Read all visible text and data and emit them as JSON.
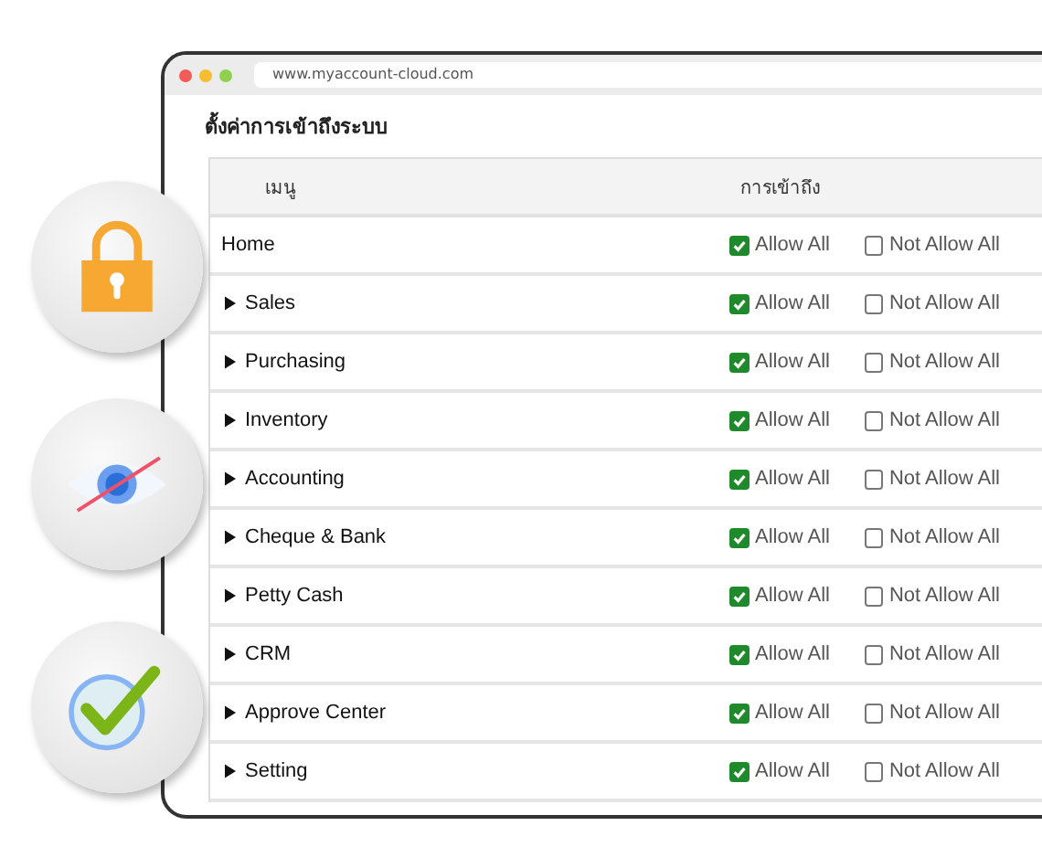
{
  "browser": {
    "url": "www.myaccount-cloud.com"
  },
  "page_title": "ตั้งค่าการเข้าถึงระบบ",
  "table": {
    "columns": [
      "เมนู",
      "การเข้าถึง"
    ],
    "rows": [
      {
        "name": "Home",
        "expandable": false,
        "allow": {
          "label": "Allow All",
          "checked": true
        },
        "deny": {
          "label": "Not Allow All",
          "checked": false
        }
      },
      {
        "name": "Sales",
        "expandable": true,
        "allow": {
          "label": "Allow All",
          "checked": true
        },
        "deny": {
          "label": "Not Allow All",
          "checked": false
        }
      },
      {
        "name": "Purchasing",
        "expandable": true,
        "allow": {
          "label": "Allow All",
          "checked": true
        },
        "deny": {
          "label": "Not Allow All",
          "checked": false
        }
      },
      {
        "name": "Inventory",
        "expandable": true,
        "allow": {
          "label": "Allow All",
          "checked": true
        },
        "deny": {
          "label": "Not Allow All",
          "checked": false
        }
      },
      {
        "name": "Accounting",
        "expandable": true,
        "allow": {
          "label": "Allow All",
          "checked": true
        },
        "deny": {
          "label": "Not Allow All",
          "checked": false
        }
      },
      {
        "name": "Cheque & Bank",
        "expandable": true,
        "allow": {
          "label": "Allow All",
          "checked": true
        },
        "deny": {
          "label": "Not Allow All",
          "checked": false
        }
      },
      {
        "name": "Petty Cash",
        "expandable": true,
        "allow": {
          "label": "Allow All",
          "checked": true
        },
        "deny": {
          "label": "Not Allow All",
          "checked": false
        }
      },
      {
        "name": "CRM",
        "expandable": true,
        "allow": {
          "label": "Allow All",
          "checked": true
        },
        "deny": {
          "label": "Not Allow All",
          "checked": false
        }
      },
      {
        "name": "Approve Center",
        "expandable": true,
        "allow": {
          "label": "Allow All",
          "checked": true
        },
        "deny": {
          "label": "Not Allow All",
          "checked": false
        }
      },
      {
        "name": "Setting",
        "expandable": true,
        "allow": {
          "label": "Allow All",
          "checked": true
        },
        "deny": {
          "label": "Not Allow All",
          "checked": false
        }
      }
    ]
  }
}
